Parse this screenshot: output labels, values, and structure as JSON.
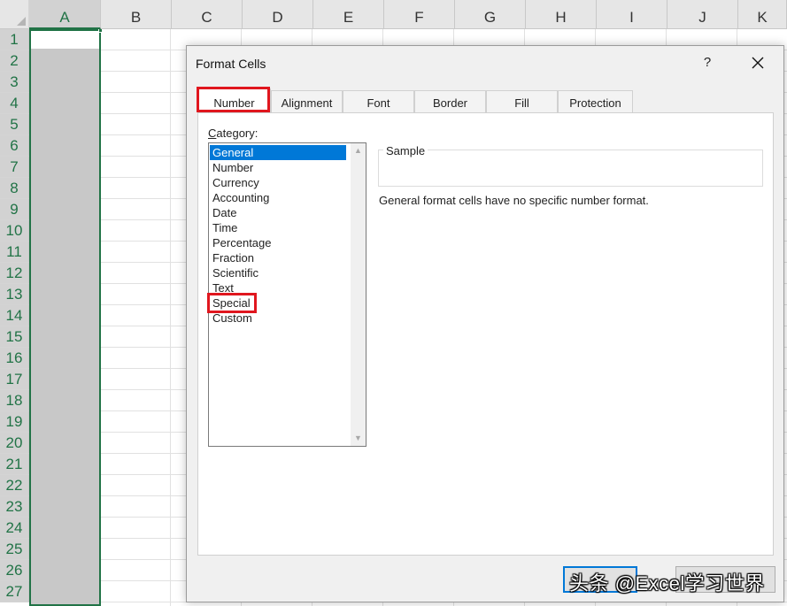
{
  "spreadsheet": {
    "columns": [
      "A",
      "B",
      "C",
      "D",
      "E",
      "F",
      "G",
      "H",
      "I",
      "J",
      "K"
    ],
    "rows": [
      "1",
      "2",
      "3",
      "4",
      "5",
      "6",
      "7",
      "8",
      "9",
      "10",
      "11",
      "12",
      "13",
      "14",
      "15",
      "16",
      "17",
      "18",
      "19",
      "20",
      "21",
      "22",
      "23",
      "24",
      "25",
      "26",
      "27"
    ],
    "selected_column": "A",
    "accent_color": "#217346"
  },
  "dialog": {
    "title": "Format Cells",
    "help_label": "?",
    "close_label": "✕",
    "tabs": [
      "Number",
      "Alignment",
      "Font",
      "Border",
      "Fill",
      "Protection"
    ],
    "active_tab": "Number",
    "category_label": "Category:",
    "categories": [
      "General",
      "Number",
      "Currency",
      "Accounting",
      "Date",
      "Time",
      "Percentage",
      "Fraction",
      "Scientific",
      "Text",
      "Special",
      "Custom"
    ],
    "selected_category": "General",
    "highlighted_category": "Special",
    "sample_label": "Sample",
    "description": "General format cells have no specific number format.",
    "watermark": "头条 @Excel学习世界",
    "highlight_color": "#e0161e",
    "selection_color": "#0078d7"
  }
}
